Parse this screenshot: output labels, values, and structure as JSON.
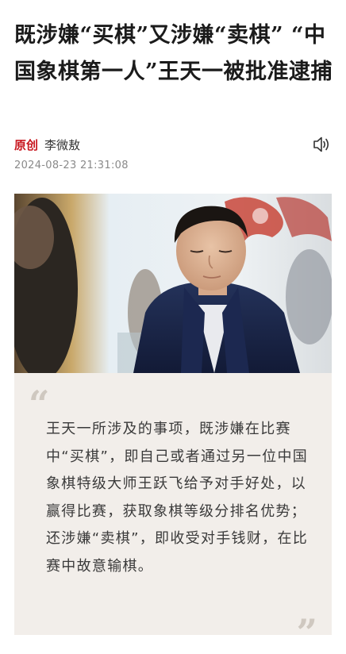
{
  "article": {
    "title": "既涉嫌“买棋”又涉嫌“卖棋” “中国象棋第一人”王天一被批准逮捕",
    "tag": "原创",
    "author": "李微敖",
    "timestamp": "2024-08-23 21:31:08",
    "photo_icon": "chess-player-photo",
    "speaker_icon": "speaker-icon",
    "quote": {
      "open_mark": "“",
      "text": "王天一所涉及的事项，既涉嫌在比赛中“买棋”，即自己或者通过另一位中国象棋特级大师王跃飞给予对手好处，以赢得比赛，获取象棋等级分排名优势；还涉嫌“卖棋”，即收受对手钱财，在比赛中故意输棋。",
      "close_mark": "”"
    }
  },
  "colors": {
    "tag": "#c8161e",
    "quote_bg": "#f2eeea",
    "timestamp": "#8a8a8a"
  }
}
